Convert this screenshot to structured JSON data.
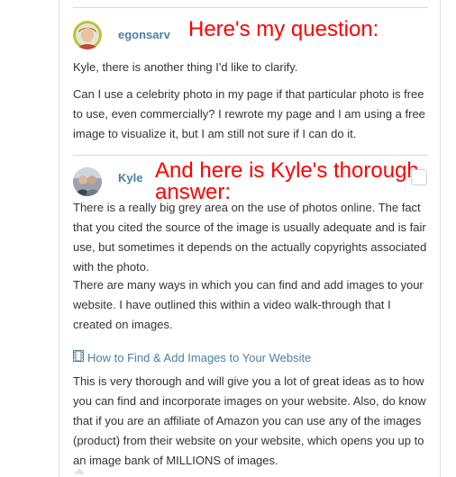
{
  "question": {
    "username": "egonsarv",
    "annotation": "Here's my question:",
    "paragraphs": [
      "Kyle, there is another thing I'd like to clarify.",
      "Can I use a celebrity photo in my  page if that particular photo is free to use, even commercially? I rewrote my  page and I am using a free image to visualize it, but I am still not sure if I can do it."
    ]
  },
  "answer": {
    "username": "Kyle",
    "annotation": "And here is Kyle's thorough answer:",
    "paragraph_1": "There is a really big grey area on the use of photos online. The fact that you cited the source of the image is usually adequate and is fair use, but sometimes it depends on the actually copyrights associated with the photo.",
    "paragraph_2": "There are many ways in which you can find and add images to your website. I have outlined this within a video walk-through that I created on images.",
    "link_label": "How to Find & Add Images to Your Website",
    "link_icon": "film-icon",
    "paragraph_3": "This is very thorough and will give you a lot of great ideas as to how you can find and incorporate images on your website. Also, do know that if you are an affiliate of Amazon you can use any of the images (product) from their website on your website, which opens you up to an image bank of MILLIONS of images."
  },
  "colors": {
    "annotation": "#ff0000",
    "username": "#4a7fa6",
    "link": "#4a7fa6",
    "body_text": "#333333"
  }
}
